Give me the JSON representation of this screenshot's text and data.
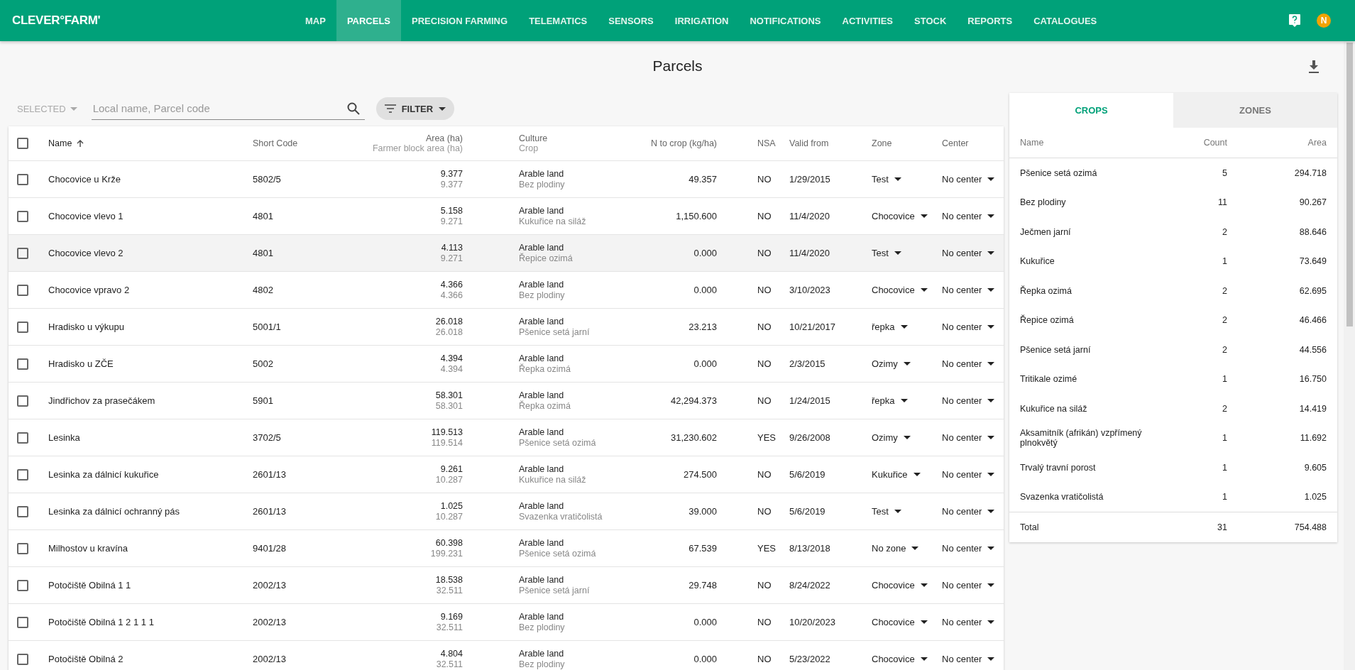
{
  "header": {
    "logo": "CLEVER°FARM'",
    "nav": [
      {
        "label": "MAP",
        "selected": false
      },
      {
        "label": "PARCELS",
        "selected": true
      },
      {
        "label": "PRECISION FARMING",
        "selected": false
      },
      {
        "label": "TELEMATICS",
        "selected": false
      },
      {
        "label": "SENSORS",
        "selected": false
      },
      {
        "label": "IRRIGATION",
        "selected": false
      },
      {
        "label": "NOTIFICATIONS",
        "selected": false
      },
      {
        "label": "ACTIVITIES",
        "selected": false
      },
      {
        "label": "STOCK",
        "selected": false
      },
      {
        "label": "REPORTS",
        "selected": false
      },
      {
        "label": "CATALOGUES",
        "selected": false
      }
    ],
    "avatar": "N"
  },
  "page_title": "Parcels",
  "toolbar": {
    "selected_dropdown": {
      "label": "SELECTED",
      "disabled": true
    },
    "search": {
      "placeholder": "Local name, Parcel code"
    },
    "filter": "FILTER"
  },
  "table": {
    "select_all_checked": false,
    "columns": [
      {
        "label": "Name",
        "sorted": true
      },
      {
        "label": "Short Code",
        "sorted": false
      },
      {
        "label": "Area (ha)",
        "sublabel": "Farmer block area (ha)",
        "sorted": false
      },
      {
        "label": "Culture",
        "sublabel": "Crop",
        "sorted": false
      },
      {
        "label": "N to crop (kg/ha)",
        "sorted": false
      },
      {
        "label": "NSA",
        "sorted": false
      },
      {
        "label": "Valid from",
        "sorted": false
      },
      {
        "label": "Zone",
        "sorted": false
      },
      {
        "label": "Center",
        "sorted": false
      }
    ],
    "rows": [
      {
        "checked": false,
        "highlighted": false,
        "name": "Chocovice u Krže",
        "short_code": "5802/5",
        "area": "9.377",
        "farmer_block_area": "9.377",
        "culture": "Arable land",
        "crop": "Bez plodiny",
        "n_to_crop": "49.357",
        "nsa": "NO",
        "valid_from": "1/29/2015",
        "zone": "Test",
        "center": "No center"
      },
      {
        "checked": false,
        "highlighted": false,
        "name": "Chocovice vlevo 1",
        "short_code": "4801",
        "area": "5.158",
        "farmer_block_area": "9.271",
        "culture": "Arable land",
        "crop": "Kukuřice na siláž",
        "n_to_crop": "1,150.600",
        "nsa": "NO",
        "valid_from": "11/4/2020",
        "zone": "Chocovice",
        "center": "No center"
      },
      {
        "checked": false,
        "highlighted": true,
        "name": "Chocovice vlevo 2",
        "short_code": "4801",
        "area": "4.113",
        "farmer_block_area": "9.271",
        "culture": "Arable land",
        "crop": "Řepice ozimá",
        "n_to_crop": "0.000",
        "nsa": "NO",
        "valid_from": "11/4/2020",
        "zone": "Test",
        "center": "No center"
      },
      {
        "checked": false,
        "highlighted": false,
        "name": "Chocovice vpravo 2",
        "short_code": "4802",
        "area": "4.366",
        "farmer_block_area": "4.366",
        "culture": "Arable land",
        "crop": "Bez plodiny",
        "n_to_crop": "0.000",
        "nsa": "NO",
        "valid_from": "3/10/2023",
        "zone": "Chocovice",
        "center": "No center"
      },
      {
        "checked": false,
        "highlighted": false,
        "name": "Hradisko u výkupu",
        "short_code": "5001/1",
        "area": "26.018",
        "farmer_block_area": "26.018",
        "culture": "Arable land",
        "crop": "Pšenice setá jarní",
        "n_to_crop": "23.213",
        "nsa": "NO",
        "valid_from": "10/21/2017",
        "zone": "řepka",
        "center": "No center"
      },
      {
        "checked": false,
        "highlighted": false,
        "name": "Hradisko u ZČE",
        "short_code": "5002",
        "area": "4.394",
        "farmer_block_area": "4.394",
        "culture": "Arable land",
        "crop": "Řepka ozimá",
        "n_to_crop": "0.000",
        "nsa": "NO",
        "valid_from": "2/3/2015",
        "zone": "Ozimy",
        "center": "No center"
      },
      {
        "checked": false,
        "highlighted": false,
        "name": "Jindřichov za prasečákem",
        "short_code": "5901",
        "area": "58.301",
        "farmer_block_area": "58.301",
        "culture": "Arable land",
        "crop": "Řepka ozimá",
        "n_to_crop": "42,294.373",
        "nsa": "NO",
        "valid_from": "1/24/2015",
        "zone": "řepka",
        "center": "No center"
      },
      {
        "checked": false,
        "highlighted": false,
        "name": "Lesinka",
        "short_code": "3702/5",
        "area": "119.513",
        "farmer_block_area": "119.514",
        "culture": "Arable land",
        "crop": "Pšenice setá ozimá",
        "n_to_crop": "31,230.602",
        "nsa": "YES",
        "valid_from": "9/26/2008",
        "zone": "Ozimy",
        "center": "No center"
      },
      {
        "checked": false,
        "highlighted": false,
        "name": "Lesinka za dálnicí kukuřice",
        "short_code": "2601/13",
        "area": "9.261",
        "farmer_block_area": "10.287",
        "culture": "Arable land",
        "crop": "Kukuřice na siláž",
        "n_to_crop": "274.500",
        "nsa": "NO",
        "valid_from": "5/6/2019",
        "zone": "Kukuřice",
        "center": "No center"
      },
      {
        "checked": false,
        "highlighted": false,
        "name": "Lesinka za dálnicí ochranný pás",
        "short_code": "2601/13",
        "area": "1.025",
        "farmer_block_area": "10.287",
        "culture": "Arable land",
        "crop": "Svazenka vratičolistá",
        "n_to_crop": "39.000",
        "nsa": "NO",
        "valid_from": "5/6/2019",
        "zone": "Test",
        "center": "No center"
      },
      {
        "checked": false,
        "highlighted": false,
        "name": "Milhostov u kravína",
        "short_code": "9401/28",
        "area": "60.398",
        "farmer_block_area": "199.231",
        "culture": "Arable land",
        "crop": "Pšenice setá ozimá",
        "n_to_crop": "67.539",
        "nsa": "YES",
        "valid_from": "8/13/2018",
        "zone": "No zone",
        "center": "No center"
      },
      {
        "checked": false,
        "highlighted": false,
        "name": "Potočiště Obilná 1 1",
        "short_code": "2002/13",
        "area": "18.538",
        "farmer_block_area": "32.511",
        "culture": "Arable land",
        "crop": "Pšenice setá jarní",
        "n_to_crop": "29.748",
        "nsa": "NO",
        "valid_from": "8/24/2022",
        "zone": "Chocovice",
        "center": "No center"
      },
      {
        "checked": false,
        "highlighted": false,
        "name": "Potočiště Obilná 1 2 1 1 1",
        "short_code": "2002/13",
        "area": "9.169",
        "farmer_block_area": "32.511",
        "culture": "Arable land",
        "crop": "Bez plodiny",
        "n_to_crop": "0.000",
        "nsa": "NO",
        "valid_from": "10/20/2023",
        "zone": "Chocovice",
        "center": "No center"
      },
      {
        "checked": false,
        "highlighted": false,
        "name": "Potočiště Obilná 2",
        "short_code": "2002/13",
        "area": "4.804",
        "farmer_block_area": "32.511",
        "culture": "Arable land",
        "crop": "Bez plodiny",
        "n_to_crop": "0.000",
        "nsa": "NO",
        "valid_from": "5/23/2022",
        "zone": "Chocovice",
        "center": "No center"
      }
    ]
  },
  "summary": {
    "tabs": [
      {
        "label": "CROPS",
        "selected": true
      },
      {
        "label": "ZONES",
        "selected": false
      }
    ],
    "columns": [
      "Name",
      "Count",
      "Area"
    ],
    "rows": [
      {
        "name": "Pšenice setá ozimá",
        "count": "5",
        "area": "294.718"
      },
      {
        "name": "Bez plodiny",
        "count": "11",
        "area": "90.267"
      },
      {
        "name": "Ječmen jarní",
        "count": "2",
        "area": "88.646"
      },
      {
        "name": "Kukuřice",
        "count": "1",
        "area": "73.649"
      },
      {
        "name": "Řepka ozimá",
        "count": "2",
        "area": "62.695"
      },
      {
        "name": "Řepice ozimá",
        "count": "2",
        "area": "46.466"
      },
      {
        "name": "Pšenice setá jarní",
        "count": "2",
        "area": "44.556"
      },
      {
        "name": "Tritikale ozimé",
        "count": "1",
        "area": "16.750"
      },
      {
        "name": "Kukuřice na siláž",
        "count": "2",
        "area": "14.419"
      },
      {
        "name": "Aksamitník (afrikán) vzpřímený plnokvětý",
        "count": "1",
        "area": "11.692"
      },
      {
        "name": "Trvalý travní porost",
        "count": "1",
        "area": "9.605"
      },
      {
        "name": "Svazenka vratičolistá",
        "count": "1",
        "area": "1.025"
      }
    ],
    "total": {
      "label": "Total",
      "count": "31",
      "area": "754.488"
    }
  }
}
